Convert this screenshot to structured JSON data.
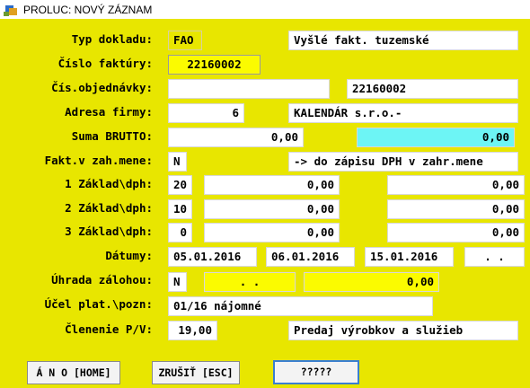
{
  "window": {
    "title": "PROLUC: NOVÝ ZÁZNAM",
    "icon": "app-icon"
  },
  "labels": {
    "typ": "Typ dokladu:",
    "cislo": "Číslo faktúry:",
    "objed": "Čís.objednávky:",
    "adresa": "Adresa firmy:",
    "suma": "Suma BRUTTO:",
    "fakt": "Fakt.v zah.mene:",
    "z1": "1 Základ\\dph:",
    "z2": "2 Základ\\dph:",
    "z3": "3 Základ\\dph:",
    "datumy": "Dátumy:",
    "uhrada": "Úhrada zálohou:",
    "ucel": "Účel plat.\\pozn:",
    "clen": "Členenie P/V:"
  },
  "fields": {
    "typ_code": "FAO",
    "typ_desc": "Vyšlé fakt. tuzemské",
    "cislo": "22160002",
    "objed_left": "",
    "objed_right": "22160002",
    "adresa_code": "6",
    "adresa_name": "KALENDÁR s.r.o.-",
    "suma": "0,00",
    "suma2": "0,00",
    "fakt_flag": "N",
    "fakt_desc": "-> do zápisu DPH v zahr.mene",
    "z1_rate": "20",
    "z1_base": "0,00",
    "z1_vat": "0,00",
    "z2_rate": "10",
    "z2_base": "0,00",
    "z2_vat": "0,00",
    "z3_rate": "0",
    "z3_base": "0,00",
    "z3_vat": "0,00",
    "datum1": "05.01.2016",
    "datum2": "06.01.2016",
    "datum3": "15.01.2016",
    "datum4": " .  . ",
    "uhrada_flag": "N",
    "uhrada_date": " .  . ",
    "uhrada_amount": "0,00",
    "ucel": "01/16 nájomné",
    "clen_code": "19,00",
    "clen_desc": "Predaj výrobkov a služieb"
  },
  "buttons": {
    "ano": "Á N O [HOME]",
    "zrusit": "ZRUŠIŤ [ESC]",
    "unknown": "?????"
  },
  "colors": {
    "form_bg": "#e8e600",
    "highlight_yellow": "#fbfb00",
    "highlight_cyan": "#6df5f5",
    "default_button_border": "#3a7fd0"
  }
}
